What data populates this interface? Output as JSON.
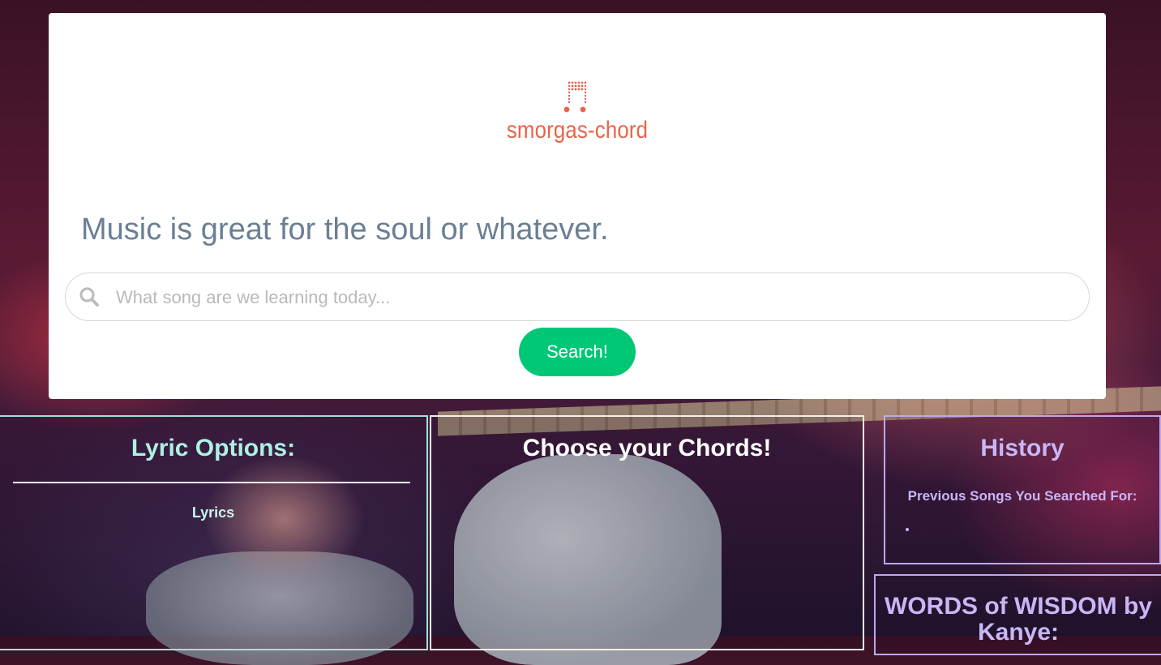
{
  "brand": {
    "name": "smorgas-chord",
    "logo_icon": "music-note-icon",
    "accent_color": "#e8644a"
  },
  "hero": {
    "tagline": "Music is great for the soul or whatever."
  },
  "search": {
    "placeholder": "What song are we learning today...",
    "value": "",
    "icon": "search-icon",
    "button_label": "Search!",
    "button_color": "#00c776"
  },
  "panels": {
    "lyrics": {
      "title": "Lyric Options:",
      "link_label": "Lyrics"
    },
    "chords": {
      "title": "Choose your Chords!"
    },
    "history": {
      "title": "History",
      "subtitle": "Previous Songs You Searched For:",
      "items": [
        ""
      ]
    },
    "wisdom": {
      "title": "WORDS of WISDOM by Kanye:"
    }
  }
}
